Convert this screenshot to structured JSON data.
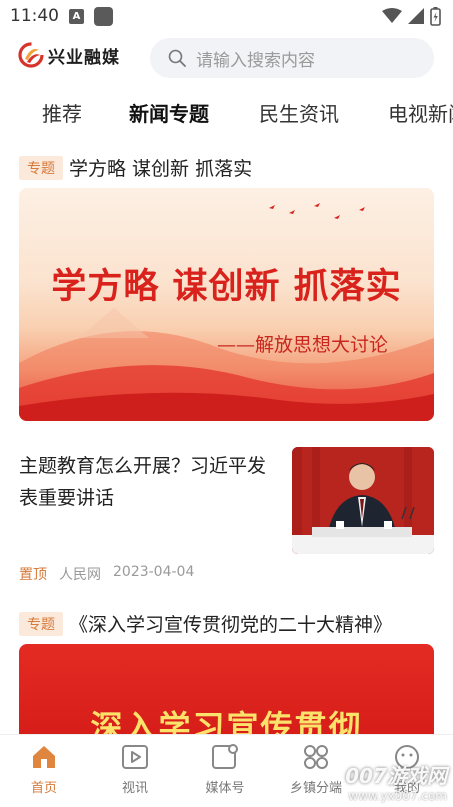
{
  "status": {
    "time": "11:40"
  },
  "header": {
    "logo_text": "兴业融媒",
    "search_placeholder": "请输入搜索内容"
  },
  "tabs": [
    {
      "label": "推荐"
    },
    {
      "label": "新闻专题"
    },
    {
      "label": "民生资讯"
    },
    {
      "label": "电视新闻"
    }
  ],
  "feed": {
    "topic1": {
      "badge": "专题",
      "title": "学方略 谋创新 抓落实",
      "banner_title": "学方略 谋创新 抓落实",
      "banner_sub": "——解放思想大讨论"
    },
    "news1": {
      "title": "主题教育怎么开展？习近平发表重要讲话",
      "pin": "置顶",
      "source": "人民网",
      "date": "2023-04-04"
    },
    "topic2": {
      "badge": "专题",
      "title": "《深入学习宣传贯彻党的二十大精神》",
      "banner_title": "深入学习宣传贯彻"
    }
  },
  "bottom_nav": [
    {
      "label": "首页",
      "icon": "home-icon",
      "active": true
    },
    {
      "label": "视讯",
      "icon": "video-icon"
    },
    {
      "label": "媒体号",
      "icon": "media-icon"
    },
    {
      "label": "乡镇分端",
      "icon": "grid-icon"
    },
    {
      "label": "我的",
      "icon": "profile-icon"
    }
  ],
  "watermark": {
    "brand": "007游戏网",
    "url": "www.yx007.com"
  },
  "colors": {
    "accent": "#d77a3a",
    "banner_red": "#d8221b"
  }
}
